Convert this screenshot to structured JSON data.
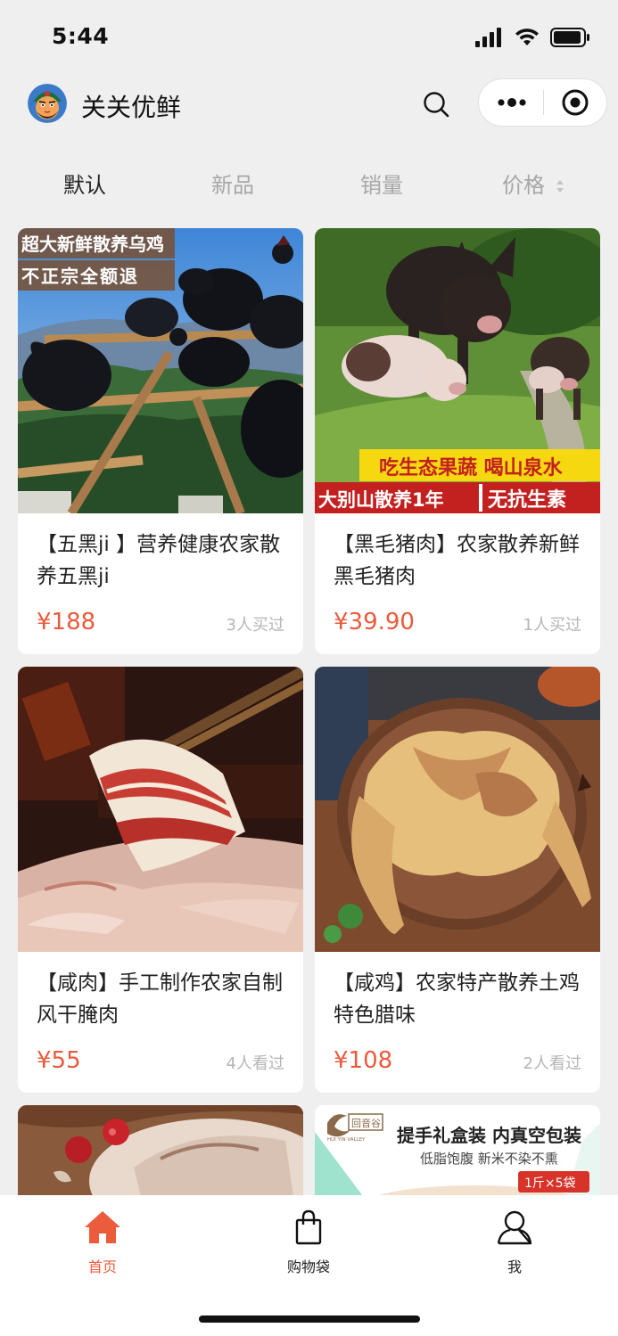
{
  "status_bar": {
    "time": "5:44"
  },
  "header": {
    "title": "关关优鲜",
    "logo_icon": "mascot-avatar",
    "search_icon": "search-icon",
    "more_icon": "more-dots-icon",
    "close_icon": "target-circle-icon"
  },
  "sort_tabs": [
    {
      "label": "默认",
      "active": true
    },
    {
      "label": "新品",
      "active": false
    },
    {
      "label": "销量",
      "active": false
    },
    {
      "label": "价格",
      "active": false
    }
  ],
  "products": [
    {
      "title": "【五黑ji 】营养健康农家散养五黑ji",
      "price": "¥188",
      "stat": "3人买过",
      "banner_lines": [
        "超大新鲜散养乌鸡",
        "不正宗全额退"
      ]
    },
    {
      "title": "【黑毛猪肉】农家散养新鲜黑毛猪肉",
      "price": "¥39.90",
      "stat": "1人买过",
      "banner_lines": [
        "吃生态果蔬 喝山泉水",
        "大别山散养1年",
        "无抗生素"
      ]
    },
    {
      "title": "【咸肉】手工制作农家自制风干腌肉",
      "price": "¥55",
      "stat": "4人看过"
    },
    {
      "title": "【咸鸡】农家特产散养土鸡特色腊味",
      "price": "¥108",
      "stat": "2人看过"
    },
    {
      "title": "",
      "price": "",
      "stat": ""
    },
    {
      "title": "",
      "price": "",
      "stat": "",
      "banner_lines": [
        "提手礼盒装 内真空包装",
        "低脂饱腹  新米不染不熏",
        "1斤×5袋"
      ],
      "brand": "回音谷",
      "brand_sub": "HUI YIN VALLEY"
    }
  ],
  "tabbar": [
    {
      "label": "首页",
      "icon": "home-icon",
      "active": true
    },
    {
      "label": "购物袋",
      "icon": "shopping-bag-icon",
      "active": false
    },
    {
      "label": "我",
      "icon": "user-icon",
      "active": false
    }
  ],
  "colors": {
    "accent": "#ea5a3c",
    "background": "#efefef",
    "card": "#ffffff",
    "muted": "#b5b5b5"
  }
}
